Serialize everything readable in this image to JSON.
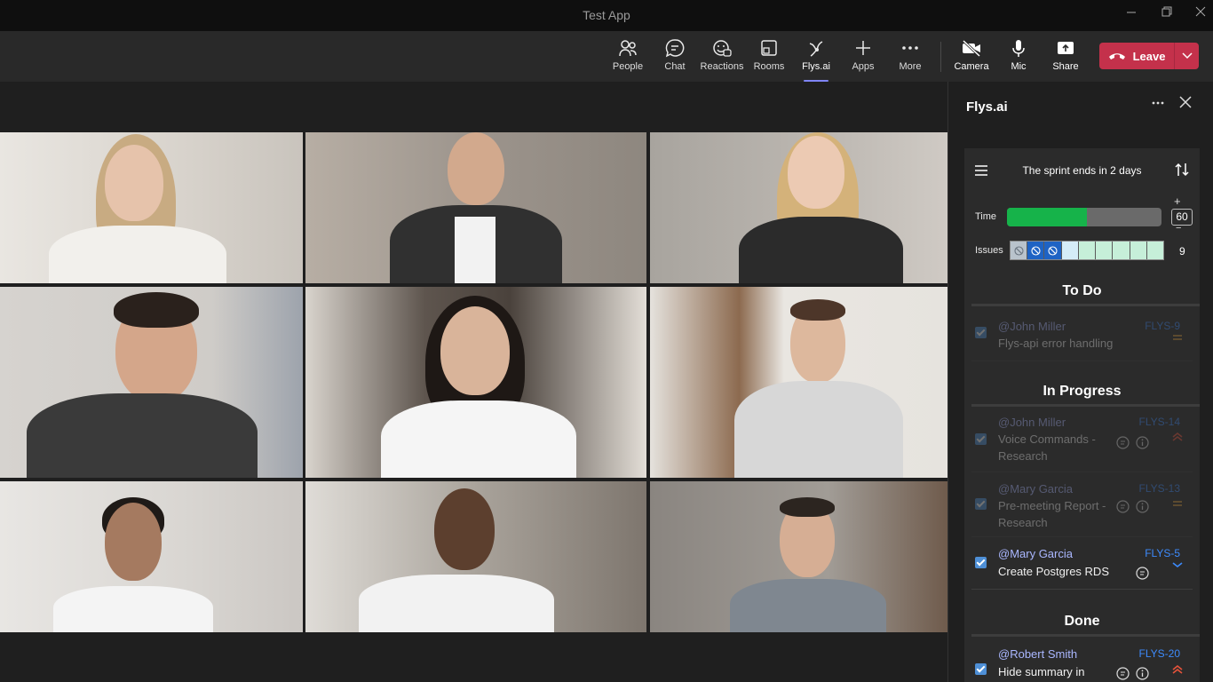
{
  "window": {
    "title": "Test App"
  },
  "toolbar": {
    "items": [
      {
        "label": "People",
        "icon": "people-icon"
      },
      {
        "label": "Chat",
        "icon": "chat-icon"
      },
      {
        "label": "Reactions",
        "icon": "reactions-icon"
      },
      {
        "label": "Rooms",
        "icon": "rooms-icon"
      },
      {
        "label": "Flys.ai",
        "icon": "flys-icon"
      },
      {
        "label": "Apps",
        "icon": "plus-icon"
      },
      {
        "label": "More",
        "icon": "more-icon"
      }
    ],
    "camera_label": "Camera",
    "mic_label": "Mic",
    "share_label": "Share",
    "leave_label": "Leave",
    "active_item": "Flys.ai",
    "colors": {
      "leave": "#c4314b",
      "accent": "#7f85f5"
    }
  },
  "panel": {
    "title": "Flys.ai",
    "sprint_text": "The sprint ends in 2 days",
    "time_label": "Time",
    "time_fraction": 0.52,
    "time_value": "60",
    "issues_label": "Issues",
    "issues_count": "9",
    "issue_segments": [
      "blocked",
      "blocked-blue",
      "blocked-blue",
      "light",
      "green",
      "green",
      "green",
      "green",
      "green"
    ],
    "colors": {
      "time_fill": "#16b34a",
      "link": "#3d8bfd",
      "mention": "#aab7ff"
    },
    "sections": {
      "todo": {
        "title": "To Do",
        "items": [
          {
            "who": "@John Miller",
            "key": "FLYS-9",
            "title": "Flys-api error handling",
            "priority": "medium"
          }
        ]
      },
      "inprogress": {
        "title": "In Progress",
        "items": [
          {
            "who": "@John Miller",
            "key": "FLYS-14",
            "title": "Voice Commands - Research",
            "priority": "high"
          },
          {
            "who": "@Mary Garcia",
            "key": "FLYS-13",
            "title": "Pre-meeting Report - Research",
            "priority": "medium"
          },
          {
            "who": "@Mary Garcia",
            "key": "FLYS-5",
            "title": "Create Postgres RDS",
            "priority": "low"
          }
        ]
      },
      "done": {
        "title": "Done",
        "items": [
          {
            "who": "@Robert Smith",
            "key": "FLYS-20",
            "title": "Hide summary in",
            "priority": "high"
          }
        ]
      }
    }
  }
}
